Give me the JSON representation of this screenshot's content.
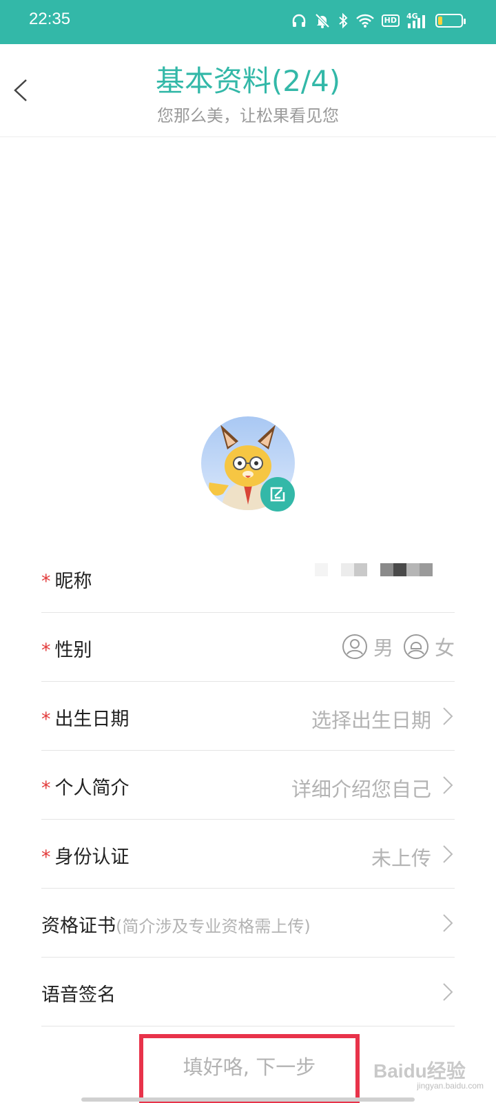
{
  "status_bar": {
    "time": "22:35",
    "icons": [
      "headphones-icon",
      "bell-muted-icon",
      "bluetooth-icon",
      "wifi-icon",
      "hd-icon",
      "4g-signal-icon",
      "battery-icon"
    ],
    "hd_label": "HD",
    "network_label": "4G",
    "battery_level": 0.2
  },
  "header": {
    "title": "基本资料(2/4)",
    "subtitle": "您那么美，让松果看见您",
    "back_icon": "chevron-left-icon"
  },
  "colors": {
    "accent": "#33b8a8",
    "required": "#e23b3b",
    "highlight": "#e8334a"
  },
  "form": {
    "nickname": {
      "required": "*",
      "label": "昵称"
    },
    "gender": {
      "required": "*",
      "label": "性别",
      "options": [
        "男",
        "女"
      ]
    },
    "birth_date": {
      "required": "*",
      "label": "出生日期",
      "value": "选择出生日期"
    },
    "intro": {
      "required": "*",
      "label": "个人简介",
      "value": "详细介绍您自己"
    },
    "identity": {
      "required": "*",
      "label": "身份认证",
      "value": "未上传"
    },
    "certificate": {
      "label": "资格证书",
      "hint": "(简介涉及专业资格需上传)"
    },
    "voice_signature": {
      "label": "语音签名"
    }
  },
  "next_button": {
    "label": "填好咯, 下一步"
  },
  "watermark": {
    "logo": "Baidu经验",
    "url": "jingyan.baidu.com"
  }
}
